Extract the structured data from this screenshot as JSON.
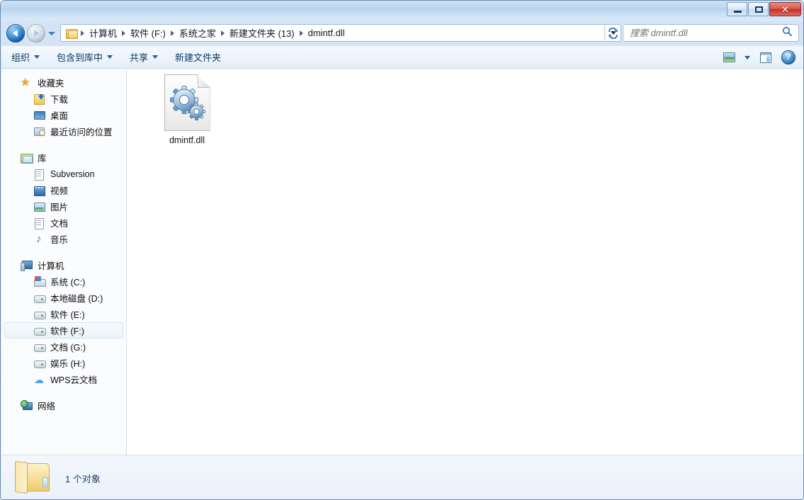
{
  "window": {
    "buttons": {
      "minimize": "minimize",
      "maximize": "restore",
      "close": "✕"
    }
  },
  "nav": {
    "back_tooltip": "后退",
    "forward_tooltip": "前进",
    "recent_pages": "最近浏览的页面",
    "refresh": "刷新"
  },
  "address": {
    "crumbs": [
      {
        "label": "计算机"
      },
      {
        "label": "软件 (F:)"
      },
      {
        "label": "系统之家"
      },
      {
        "label": "新建文件夹 (13)"
      },
      {
        "label": "dmintf.dll"
      }
    ]
  },
  "search": {
    "placeholder": "搜索 dmintf.dll",
    "value": ""
  },
  "toolbar": {
    "items": [
      {
        "label": "组织",
        "caret": true
      },
      {
        "label": "包含到库中",
        "caret": true
      },
      {
        "label": "共享",
        "caret": true
      },
      {
        "label": "新建文件夹",
        "caret": false
      }
    ],
    "right": {
      "view_label": "更改您的视图",
      "preview_label": "显示预览窗格",
      "help_label": "?"
    }
  },
  "sidebar": {
    "groups": [
      {
        "header": {
          "label": "收藏夹",
          "icon": "star-icon"
        },
        "items": [
          {
            "label": "下载",
            "icon": "download-icon"
          },
          {
            "label": "桌面",
            "icon": "desktop-icon"
          },
          {
            "label": "最近访问的位置",
            "icon": "recent-places-icon"
          }
        ]
      },
      {
        "header": {
          "label": "库",
          "icon": "library-icon"
        },
        "items": [
          {
            "label": "Subversion",
            "icon": "subversion-icon"
          },
          {
            "label": "视频",
            "icon": "video-icon"
          },
          {
            "label": "图片",
            "icon": "picture-icon"
          },
          {
            "label": "文档",
            "icon": "document-icon"
          },
          {
            "label": "音乐",
            "icon": "music-icon"
          }
        ]
      },
      {
        "header": {
          "label": "计算机",
          "icon": "computer-icon"
        },
        "items": [
          {
            "label": "系统 (C:)",
            "icon": "system-drive-icon",
            "selected": false
          },
          {
            "label": "本地磁盘 (D:)",
            "icon": "drive-icon",
            "selected": false
          },
          {
            "label": "软件 (E:)",
            "icon": "drive-icon",
            "selected": false
          },
          {
            "label": "软件 (F:)",
            "icon": "drive-icon",
            "selected": true
          },
          {
            "label": "文档 (G:)",
            "icon": "drive-icon",
            "selected": false
          },
          {
            "label": "娱乐 (H:)",
            "icon": "drive-icon",
            "selected": false
          },
          {
            "label": "WPS云文档",
            "icon": "cloud-icon",
            "selected": false
          }
        ]
      },
      {
        "header": {
          "label": "网络",
          "icon": "network-icon"
        },
        "items": []
      }
    ]
  },
  "content": {
    "files": [
      {
        "name": "dmintf.dll",
        "icon": "dll-gears-icon"
      }
    ]
  },
  "status": {
    "text": "1 个对象",
    "folder_icon": "folder-icon"
  },
  "colors": {
    "accent": "#1d6fc4",
    "close_button": "#bf3026",
    "titlebar": "#b8d4ee",
    "selection": "#eaf2f9",
    "folder_yellow": "#f6dc93"
  }
}
